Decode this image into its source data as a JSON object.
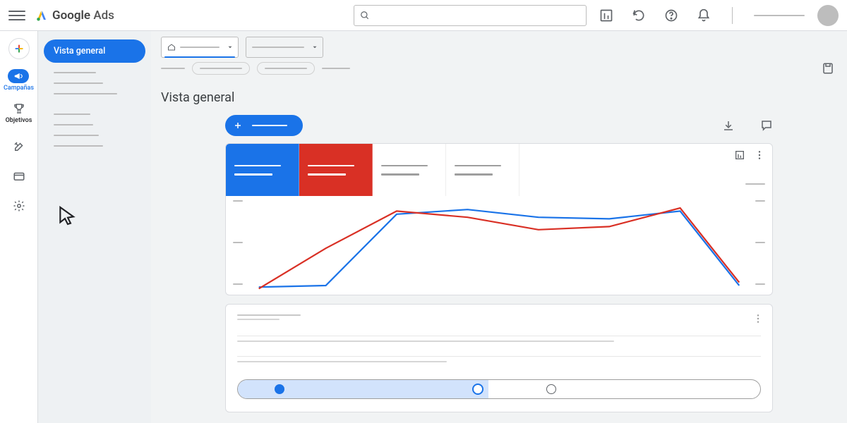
{
  "header": {
    "product_name_1": "Google",
    "product_name_2": "Ads",
    "search_placeholder": ""
  },
  "rail": {
    "items": [
      {
        "key": "campaigns",
        "label": "Campañas"
      },
      {
        "key": "objectives",
        "label": "Objetivos"
      }
    ]
  },
  "sidebar": {
    "active_label": "Vista general"
  },
  "page": {
    "title": "Vista general"
  },
  "metric_tabs": {
    "colors": [
      "#1a73e8",
      "#d93025",
      "#ffffff",
      "#ffffff"
    ]
  },
  "chart_data": {
    "type": "line",
    "x": [
      0,
      1,
      2,
      3,
      4,
      5,
      6,
      7
    ],
    "series": [
      {
        "name": "metric_blue",
        "color": "#1a73e8",
        "values": [
          10,
          12,
          90,
          95,
          88,
          86,
          93,
          12
        ]
      },
      {
        "name": "metric_red",
        "color": "#d93025",
        "values": [
          8,
          60,
          94,
          88,
          78,
          80,
          96,
          15
        ]
      }
    ],
    "ylim": [
      0,
      100
    ],
    "title": "",
    "xlabel": "",
    "ylabel": ""
  },
  "stepper": {
    "progress_percent": 48,
    "steps": 3,
    "current_step": 2
  }
}
